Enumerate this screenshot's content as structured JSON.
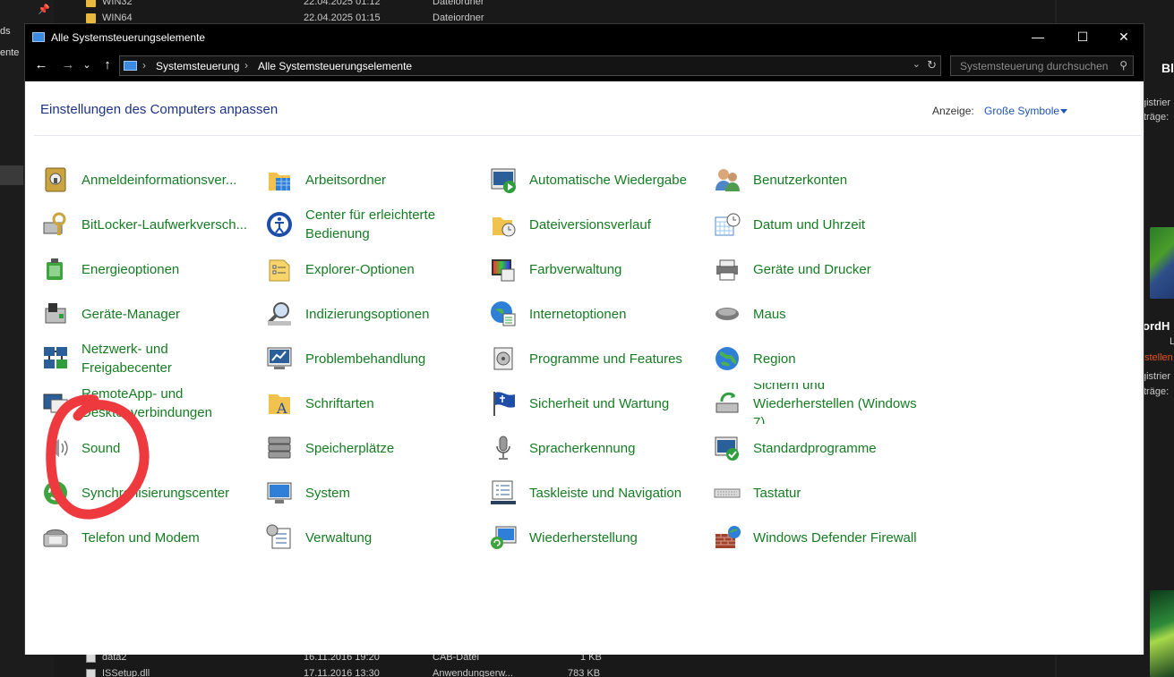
{
  "background": {
    "left_labels": [
      "ds",
      "ente"
    ],
    "files_top": [
      {
        "name": "WIN32",
        "date": "22.04.2025 01:12",
        "type": "Dateiordner",
        "size": "",
        "kind": "folder"
      },
      {
        "name": "WIN64",
        "date": "22.04.2025 01:15",
        "type": "Dateiordner",
        "size": "",
        "kind": "folder"
      }
    ],
    "files_bottom": [
      {
        "name": "data2",
        "date": "16.11.2016 19:20",
        "type": "CAB-Datei",
        "size": "1 KB",
        "kind": "file"
      },
      {
        "name": "ISSetup.dll",
        "date": "17.11.2016 13:30",
        "type": "Anwendungserw...",
        "size": "783 KB",
        "kind": "file"
      }
    ],
    "right_texts": [
      "Bl",
      "gistrier",
      "träge:",
      "ordH",
      "L",
      "stellen",
      "gistrier",
      "träge:"
    ]
  },
  "window": {
    "title": "Alle Systemsteuerungselemente",
    "minimize": "—",
    "maximize": "☐",
    "close": "✕",
    "nav": {
      "back": "←",
      "forward": "→",
      "recent": "⌄",
      "up": "↑"
    },
    "breadcrumb": [
      "Systemsteuerung",
      "Alle Systemsteuerungselemente"
    ],
    "search_placeholder": "Systemsteuerung durchsuchen",
    "page_title": "Einstellungen des Computers anpassen",
    "view_label": "Anzeige:",
    "view_value": "Große Symbole"
  },
  "items": [
    {
      "label": "Anmeldeinformationsver...",
      "icon": "credential-manager-icon",
      "col": 0,
      "row": 0
    },
    {
      "label": "Arbeitsordner",
      "icon": "work-folders-icon",
      "col": 1,
      "row": 0
    },
    {
      "label": "Automatische Wiedergabe",
      "icon": "autoplay-icon",
      "col": 2,
      "row": 0
    },
    {
      "label": "Benutzerkonten",
      "icon": "user-accounts-icon",
      "col": 3,
      "row": 0
    },
    {
      "label": "BitLocker-Laufwerkversch...",
      "icon": "bitlocker-icon",
      "col": 0,
      "row": 1
    },
    {
      "label": "Center für erleichterte Bedienung",
      "icon": "ease-of-access-icon",
      "col": 1,
      "row": 1
    },
    {
      "label": "Dateiversionsverlauf",
      "icon": "file-history-icon",
      "col": 2,
      "row": 1
    },
    {
      "label": "Datum und Uhrzeit",
      "icon": "date-time-icon",
      "col": 3,
      "row": 1
    },
    {
      "label": "Energieoptionen",
      "icon": "power-options-icon",
      "col": 0,
      "row": 2
    },
    {
      "label": "Explorer-Optionen",
      "icon": "explorer-options-icon",
      "col": 1,
      "row": 2
    },
    {
      "label": "Farbverwaltung",
      "icon": "color-management-icon",
      "col": 2,
      "row": 2
    },
    {
      "label": "Geräte und Drucker",
      "icon": "devices-printers-icon",
      "col": 3,
      "row": 2
    },
    {
      "label": "Geräte-Manager",
      "icon": "device-manager-icon",
      "col": 0,
      "row": 3
    },
    {
      "label": "Indizierungsoptionen",
      "icon": "indexing-options-icon",
      "col": 1,
      "row": 3
    },
    {
      "label": "Internetoptionen",
      "icon": "internet-options-icon",
      "col": 2,
      "row": 3
    },
    {
      "label": "Maus",
      "icon": "mouse-icon",
      "col": 3,
      "row": 3
    },
    {
      "label": "Netzwerk- und Freigabecenter",
      "icon": "network-sharing-icon",
      "col": 0,
      "row": 4
    },
    {
      "label": "Problembehandlung",
      "icon": "troubleshooting-icon",
      "col": 1,
      "row": 4
    },
    {
      "label": "Programme und Features",
      "icon": "programs-features-icon",
      "col": 2,
      "row": 4
    },
    {
      "label": "Region",
      "icon": "region-icon",
      "col": 3,
      "row": 4
    },
    {
      "label": "RemoteApp- und Desktopverbindungen",
      "icon": "remoteapp-icon",
      "col": 0,
      "row": 5
    },
    {
      "label": "Schriftarten",
      "icon": "fonts-icon",
      "col": 1,
      "row": 5
    },
    {
      "label": "Sicherheit und Wartung",
      "icon": "security-maintenance-icon",
      "col": 2,
      "row": 5
    },
    {
      "label": "Sichern und Wiederherstellen (Windows 7)",
      "icon": "backup-restore-icon",
      "col": 3,
      "row": 5
    },
    {
      "label": "Sound",
      "icon": "sound-icon",
      "col": 0,
      "row": 6
    },
    {
      "label": "Speicherplätze",
      "icon": "storage-spaces-icon",
      "col": 1,
      "row": 6
    },
    {
      "label": "Spracherkennung",
      "icon": "speech-recognition-icon",
      "col": 2,
      "row": 6
    },
    {
      "label": "Standardprogramme",
      "icon": "default-programs-icon",
      "col": 3,
      "row": 6
    },
    {
      "label": "Synchronisierungscenter",
      "icon": "sync-center-icon",
      "col": 0,
      "row": 7
    },
    {
      "label": "System",
      "icon": "system-icon",
      "col": 1,
      "row": 7
    },
    {
      "label": "Taskleiste und Navigation",
      "icon": "taskbar-navigation-icon",
      "col": 2,
      "row": 7
    },
    {
      "label": "Tastatur",
      "icon": "keyboard-icon",
      "col": 3,
      "row": 7
    },
    {
      "label": "Telefon und Modem",
      "icon": "phone-modem-icon",
      "col": 0,
      "row": 8
    },
    {
      "label": "Verwaltung",
      "icon": "administrative-tools-icon",
      "col": 1,
      "row": 8
    },
    {
      "label": "Wiederherstellung",
      "icon": "recovery-icon",
      "col": 2,
      "row": 8
    },
    {
      "label": "Windows Defender Firewall",
      "icon": "firewall-icon",
      "col": 3,
      "row": 8
    }
  ],
  "annotation": {
    "color": "#ee3a3e",
    "target": "Sound"
  },
  "colors": {
    "link_green": "#157c22",
    "title_blue": "#1e3287",
    "accent_blue": "#1e54b5"
  }
}
